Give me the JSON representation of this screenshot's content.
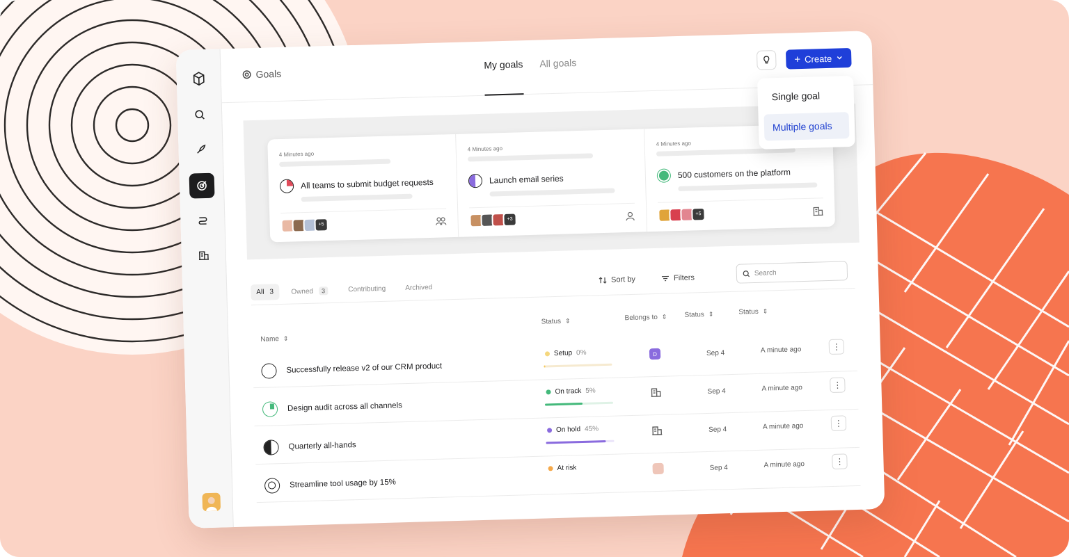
{
  "colors": {
    "background": "#fbd3c5",
    "accent_orange": "#f6754f",
    "brand_blue": "#1f3fd9"
  },
  "sidebar": {
    "items": [
      {
        "icon": "logo-icon"
      },
      {
        "icon": "search-icon"
      },
      {
        "icon": "rocket-icon"
      },
      {
        "icon": "goals-target-icon",
        "active": true
      },
      {
        "icon": "route-icon"
      },
      {
        "icon": "building-icon"
      }
    ]
  },
  "header": {
    "breadcrumb": "Goals",
    "tabs": [
      {
        "label": "My goals",
        "active": true
      },
      {
        "label": "All goals"
      }
    ],
    "create_label": "Create"
  },
  "create_menu": {
    "items": [
      "Single goal",
      "Multiple goals"
    ]
  },
  "recent_cards": [
    {
      "time": "4 Minutes ago",
      "title": "All teams to submit budget requests",
      "more": "+5",
      "owner_icon": "team-icon"
    },
    {
      "time": "4 Minutes ago",
      "title": "Launch email series",
      "more": "+3",
      "owner_icon": "person-icon"
    },
    {
      "time": "4 Minutes ago",
      "title": "500 customers on the platform",
      "more": "+5",
      "owner_icon": "building-icon"
    }
  ],
  "filters": {
    "tabs": [
      {
        "label": "All",
        "count": "3"
      },
      {
        "label": "Owned",
        "count": "3"
      },
      {
        "label": "Contributing"
      },
      {
        "label": "Archived"
      }
    ],
    "sort_label": "Sort by",
    "filters_label": "Filters",
    "search_placeholder": "Search"
  },
  "table": {
    "headers": [
      "Name",
      "Status",
      "Belongs to",
      "Status",
      "Status"
    ],
    "rows": [
      {
        "name": "Successfully release v2 of our CRM product",
        "status": "Setup",
        "pct": "0%",
        "progress": 0.0,
        "status_color": "#f5d77e",
        "belongs": "D",
        "date": "Sep 4",
        "updated": "A minute ago"
      },
      {
        "name": "Design audit across all channels",
        "status": "On track",
        "pct": "5%",
        "progress": 0.55,
        "status_color": "#44b97b",
        "belongs": "building",
        "date": "Sep 4",
        "updated": "A minute ago"
      },
      {
        "name": "Quarterly all-hands",
        "status": "On hold",
        "pct": "45%",
        "progress": 0.88,
        "status_color": "#8a6bde",
        "belongs": "building",
        "date": "Sep 4",
        "updated": "A minute ago"
      },
      {
        "name": "Streamline tool usage by 15%",
        "status": "At risk",
        "pct": "",
        "progress": null,
        "status_color": "#f5a94a",
        "belongs": "avatar",
        "date": "Sep 4",
        "updated": "A minute ago"
      }
    ]
  }
}
